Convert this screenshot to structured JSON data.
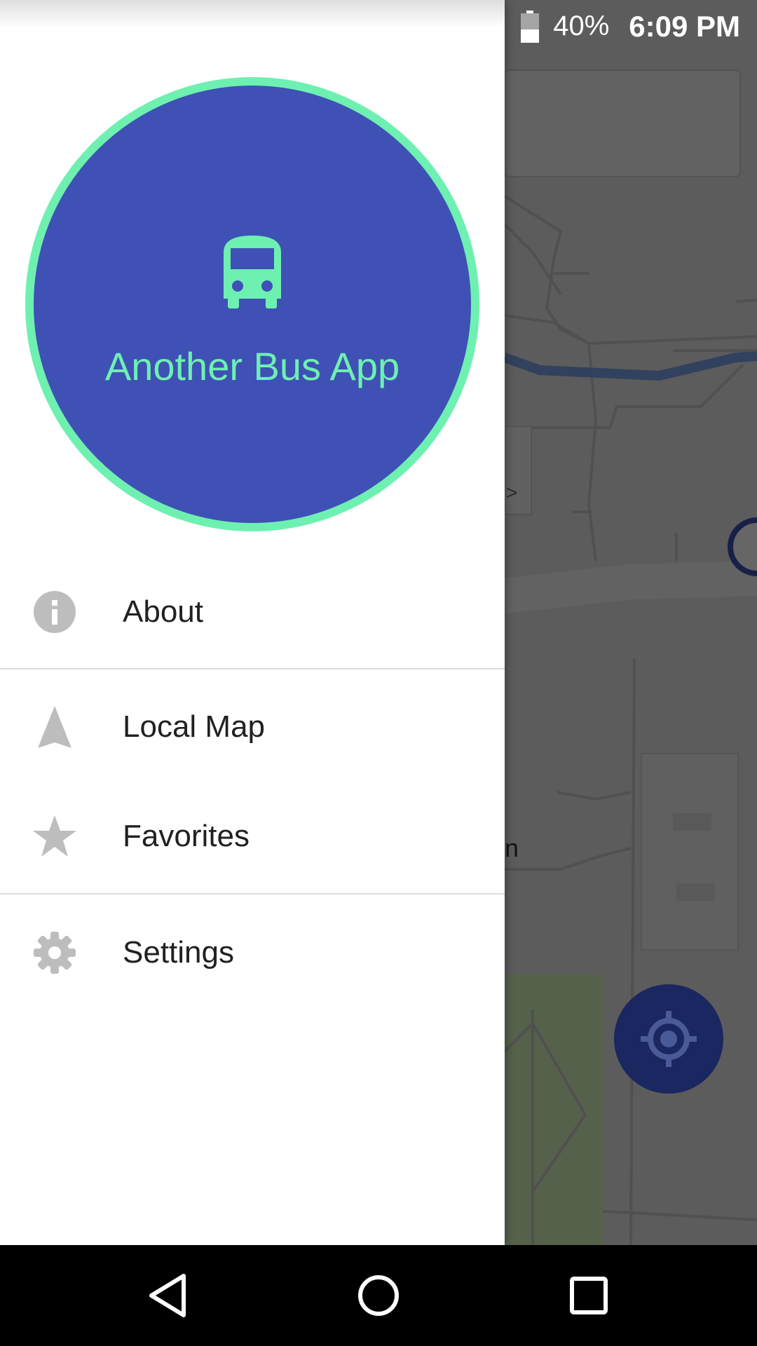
{
  "status_bar": {
    "battery_percent": "40%",
    "time": "6:09 PM",
    "icons": [
      "alarm-icon",
      "wifi-icon",
      "battery-icon"
    ]
  },
  "drawer": {
    "header": {
      "app_title": "Another Bus App",
      "icon": "bus-icon",
      "circle_color": "#3f51b5",
      "accent_color": "#6ef0b1"
    },
    "menu": [
      {
        "id": "about",
        "label": "About",
        "icon": "info-icon"
      },
      {
        "id": "local-map",
        "label": "Local Map",
        "icon": "navigation-arrow-icon"
      },
      {
        "id": "favorites",
        "label": "Favorites",
        "icon": "star-icon"
      },
      {
        "id": "settings",
        "label": "Settings",
        "icon": "gear-icon"
      }
    ]
  },
  "map": {
    "fab_icon": "my-location-icon",
    "fab_color": "#1a2760"
  },
  "nav_bar": {
    "buttons": [
      "back-icon",
      "home-icon",
      "recents-icon"
    ]
  }
}
